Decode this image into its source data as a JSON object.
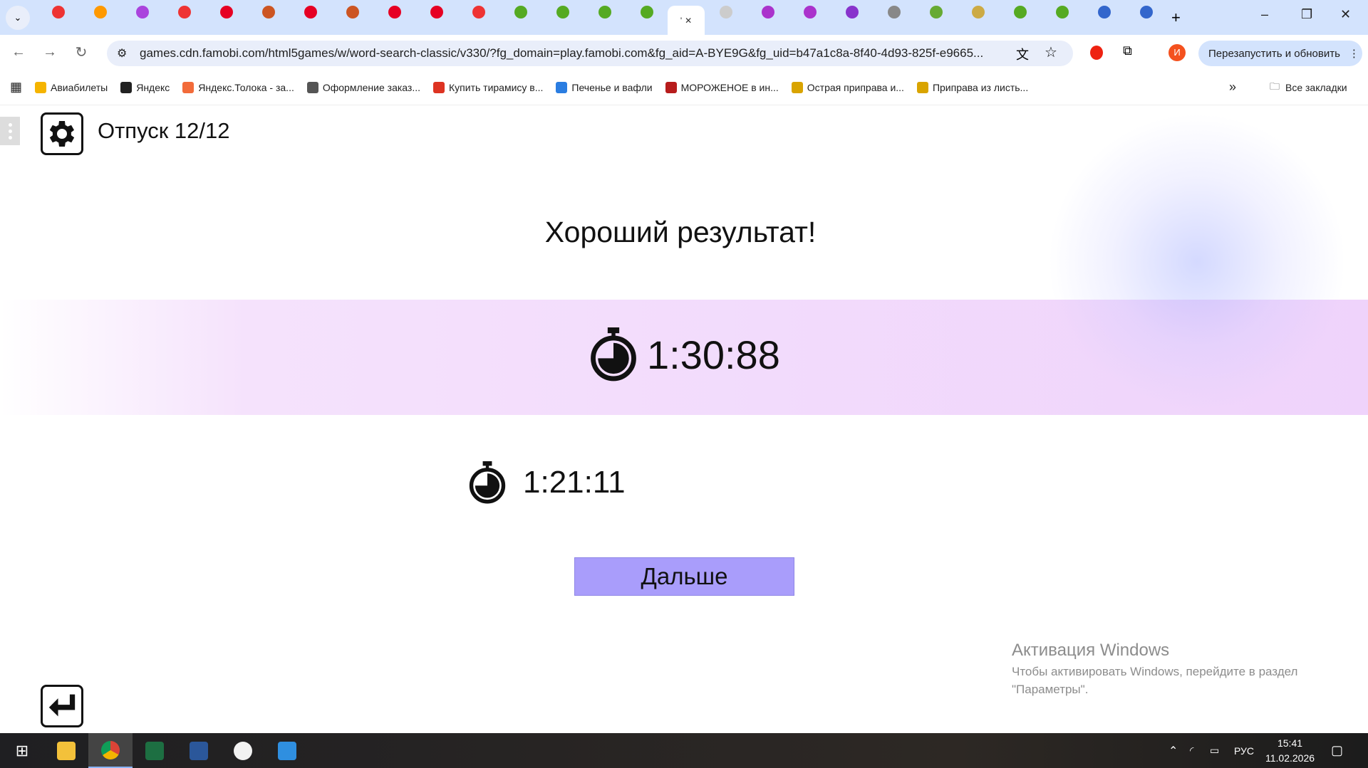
{
  "browser": {
    "tab_count": 29,
    "active_tab_label": "'",
    "url": "games.cdn.famobi.com/html5games/w/word-search-classic/v330/?fg_domain=play.famobi.com&fg_aid=A-BYE9G&fg_uid=b47a1c8a-8f40-4d93-825f-e9665...",
    "restart_label": "Перезапустить и обновить",
    "profile_initial": "И",
    "bookmarks": [
      {
        "label": "Авиабилеты",
        "color": "#f5b400"
      },
      {
        "label": "Яндекс",
        "color": "#222"
      },
      {
        "label": "Яндекс.Толока - за...",
        "color": "#f26b3a"
      },
      {
        "label": "Оформление заказ...",
        "color": "#555"
      },
      {
        "label": "Купить тирамису в...",
        "color": "#d32"
      },
      {
        "label": "Печенье и вафли",
        "color": "#2a7de1"
      },
      {
        "label": "МОРОЖЕНОЕ в ин...",
        "color": "#b71c1c"
      },
      {
        "label": "Острая приправа и...",
        "color": "#d9a400"
      },
      {
        "label": "Приправа из листь...",
        "color": "#d9a400"
      }
    ],
    "all_bookmarks": "Все закладки"
  },
  "game": {
    "level_title": "Отпуск 12/12",
    "headline": "Хороший результат!",
    "current_time": "1:30:88",
    "best_time": "1:21:11",
    "next_button": "Дальше"
  },
  "watermark": {
    "title": "Активация Windows",
    "line1": "Чтобы активировать Windows, перейдите в раздел",
    "line2": "\"Параметры\"."
  },
  "taskbar": {
    "lang": "РУС",
    "time": "15:41",
    "date": "11.02.2026"
  }
}
